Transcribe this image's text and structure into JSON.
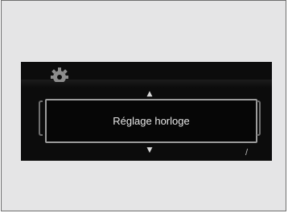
{
  "screen": {
    "setting_label": "Réglage horloge",
    "scroll_up_glyph": "▲",
    "scroll_down_glyph": "▼",
    "page_indicator": "/",
    "settings_icon": "gear-icon"
  },
  "colors": {
    "page_background": "#e5e5e6",
    "display_background": "#0c0c0c",
    "selection_border": "#9c9c9c",
    "text": "#e6e6e6"
  }
}
